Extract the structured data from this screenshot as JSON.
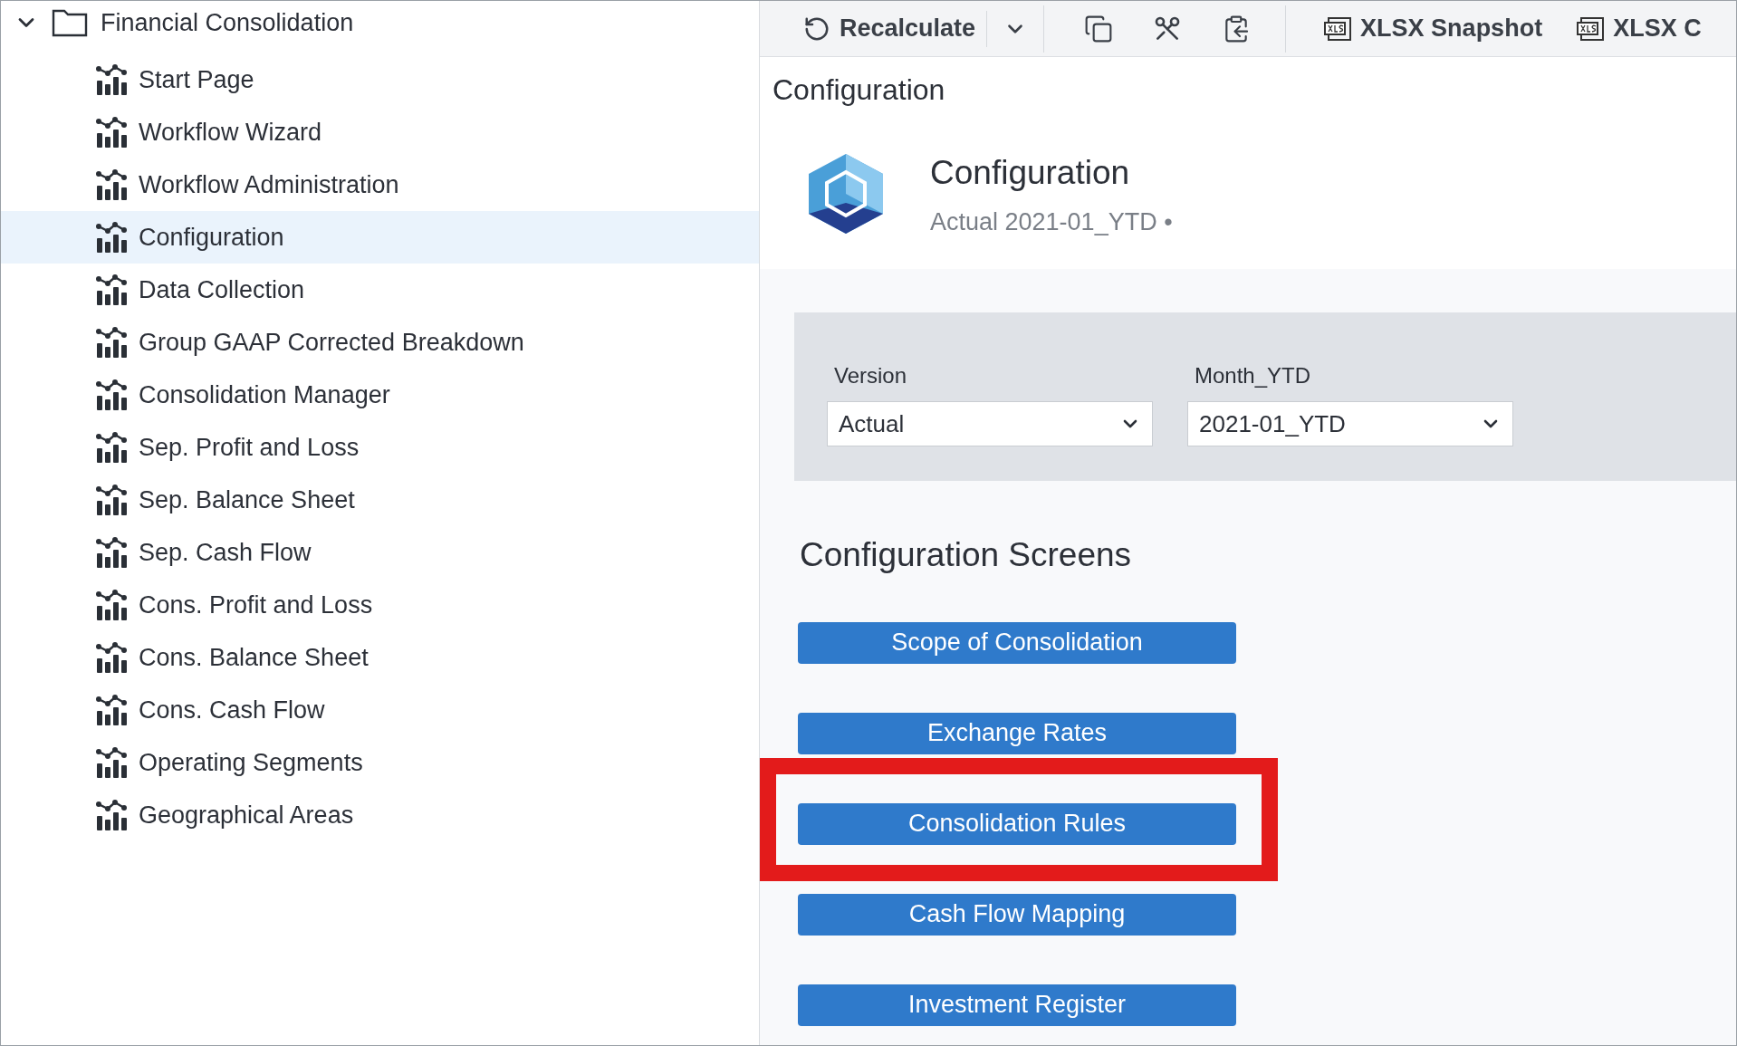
{
  "tree": {
    "label": "Financial Consolidation",
    "expanded": true,
    "children": [
      {
        "label": "Start Page",
        "selected": false
      },
      {
        "label": "Workflow Wizard",
        "selected": false
      },
      {
        "label": "Workflow Administration",
        "selected": false
      },
      {
        "label": "Configuration",
        "selected": true
      },
      {
        "label": "Data Collection",
        "selected": false
      },
      {
        "label": "Group GAAP Corrected Breakdown",
        "selected": false
      },
      {
        "label": "Consolidation Manager",
        "selected": false
      },
      {
        "label": "Sep. Profit and Loss",
        "selected": false
      },
      {
        "label": "Sep. Balance Sheet",
        "selected": false
      },
      {
        "label": "Sep. Cash Flow",
        "selected": false
      },
      {
        "label": "Cons. Profit and Loss",
        "selected": false
      },
      {
        "label": "Cons. Balance Sheet",
        "selected": false
      },
      {
        "label": "Cons. Cash Flow",
        "selected": false
      },
      {
        "label": "Operating Segments",
        "selected": false
      },
      {
        "label": "Geographical Areas",
        "selected": false
      }
    ]
  },
  "toolbar": {
    "recalculate": "Recalculate",
    "exports": [
      "XLSX Snapshot",
      "XLSX C"
    ]
  },
  "page_title": "Configuration",
  "header": {
    "title": "Configuration",
    "subtitle": "Actual 2021-01_YTD •"
  },
  "filters": [
    {
      "label": "Version",
      "value": "Actual"
    },
    {
      "label": "Month_YTD",
      "value": "2021-01_YTD"
    }
  ],
  "screens": {
    "title": "Configuration Screens",
    "buttons": [
      {
        "label": "Scope of Consolidation",
        "highlighted": false
      },
      {
        "label": "Exchange Rates",
        "highlighted": false
      },
      {
        "label": "Consolidation Rules",
        "highlighted": true
      },
      {
        "label": "Cash Flow Mapping",
        "highlighted": false
      },
      {
        "label": "Investment Register",
        "highlighted": false
      }
    ]
  }
}
